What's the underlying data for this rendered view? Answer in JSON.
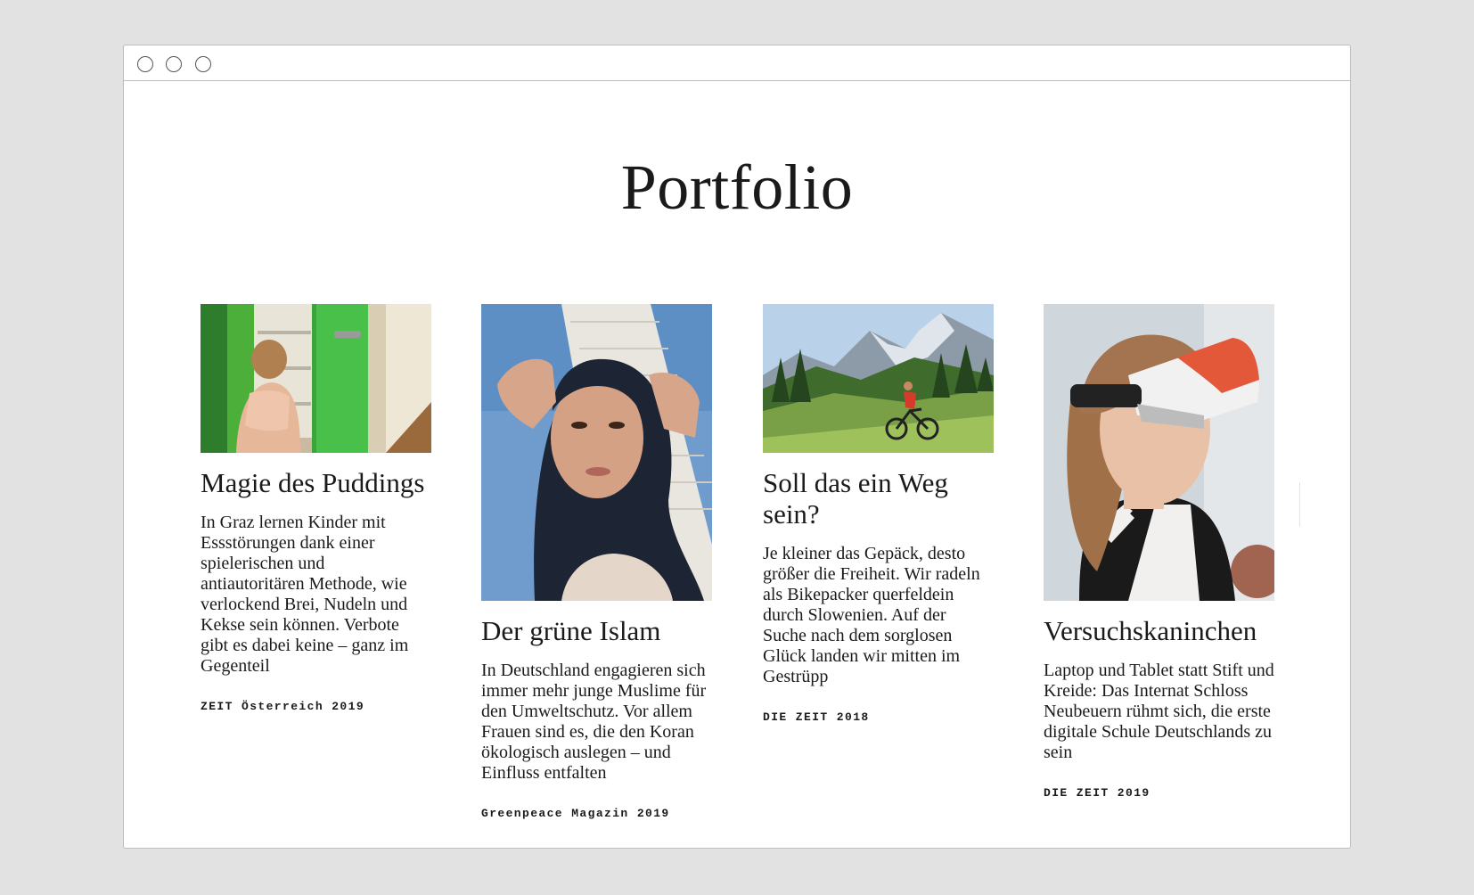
{
  "window": {
    "controls": [
      "close",
      "minimize",
      "maximize"
    ]
  },
  "page": {
    "title": "Portfolio"
  },
  "cards": [
    {
      "title": "Magie des Puddings",
      "text": "In Graz lernen Kinder mit Essstörungen dank einer spielerischen und antiautoritären Methode, wie verlockend Brei, Nudeln und Kekse sein können. Verbote gibt es dabei keine – ganz im Gegenteil",
      "source": "ZEIT Österreich 2019"
    },
    {
      "title": "Der grüne Islam",
      "text": "In Deutschland engagieren sich immer mehr junge Muslime für den Umweltschutz. Vor allem Frauen sind es, die den Koran ökologisch auslegen – und Einfluss entfalten",
      "source": "Greenpeace Magazin 2019"
    },
    {
      "title": "Soll das ein Weg sein?",
      "text": "Je kleiner das Gepäck, desto größer die Freiheit. Wir radeln als Bikepacker querfeldein durch Slowenien. Auf der Suche nach dem sorglosen Glück landen wir mitten im Gestrüpp",
      "source": "DIE ZEIT 2018"
    },
    {
      "title": "Versuchskaninchen",
      "text": "Laptop und Tablet statt Stift und Kreide: Das Internat Schloss Neubeuern rühmt sich, die erste digitale Schule Deutschlands zu sein",
      "source": "DIE ZEIT 2019"
    }
  ]
}
